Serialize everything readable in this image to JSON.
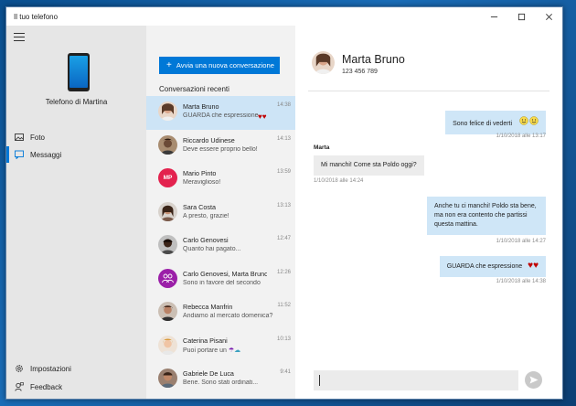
{
  "window": {
    "title": "Il tuo telefono"
  },
  "sidebar": {
    "phone_name": "Telefono di Martina",
    "nav": [
      {
        "label": "Foto",
        "icon": "photo-icon"
      },
      {
        "label": "Messaggi",
        "icon": "message-icon",
        "active": true
      }
    ],
    "footer": [
      {
        "label": "Impostazioni",
        "icon": "gear-icon"
      },
      {
        "label": "Feedback",
        "icon": "feedback-icon"
      }
    ]
  },
  "conversations": {
    "new_button": "Avvia una nuova conversazione",
    "recent_label": "Conversazioni recenti",
    "items": [
      {
        "name": "Marta Bruno",
        "preview": "GUARDA che espressione",
        "time": "14:38",
        "selected": true,
        "avatar_color": "#c98a6a"
      },
      {
        "name": "Riccardo Udinese",
        "preview": "Deve essere proprio bello!",
        "time": "14:13",
        "avatar_color": "#5b4636"
      },
      {
        "name": "Mario Pinto",
        "preview": "Meraviglioso!",
        "time": "13:59",
        "initials": "MP",
        "avatar_color": "#e3224e"
      },
      {
        "name": "Sara Costa",
        "preview": "A presto, grazie!",
        "time": "13:13",
        "avatar_color": "#8a6a5a"
      },
      {
        "name": "Carlo Genovesi",
        "preview": "Quanto hai pagato...",
        "time": "12:47",
        "avatar_color": "#3a2a22"
      },
      {
        "name": "Carlo Genovesi, Marta Bruno",
        "preview": "Sono in favore del secondo",
        "time": "12:26",
        "avatar_color": "#9b1fa8"
      },
      {
        "name": "Rebecca Manfrin",
        "preview": "Andiamo al mercato domenica?",
        "time": "11:52",
        "avatar_color": "#a97a5e"
      },
      {
        "name": "Caterina Pisani",
        "preview": "Puoi portare un",
        "time": "10:13",
        "avatar_color": "#e8b48e"
      },
      {
        "name": "Gabriele De Luca",
        "preview": "Bene. Sono stati ordinati...",
        "time": "9:41",
        "avatar_color": "#6a4a3a"
      }
    ]
  },
  "chat": {
    "contact_name": "Marta Bruno",
    "contact_number": "123 456 789",
    "messages": [
      {
        "text": "Sono felice di vederti",
        "meta": "1/10/2018 alle 13:17",
        "direction": "out"
      },
      {
        "sender": "Marta",
        "text": "Mi manchi! Come sta Poldo oggi?",
        "meta": "1/10/2018 alle 14:24",
        "direction": "in"
      },
      {
        "text": "Anche tu ci manchi! Poldo sta bene, ma non era contento che partissi questa mattina.",
        "meta": "1/10/2018 alle 14:27",
        "direction": "out"
      },
      {
        "text": "GUARDA che espressione",
        "meta": "1/10/2018 alle 14:38",
        "direction": "out"
      }
    ]
  }
}
